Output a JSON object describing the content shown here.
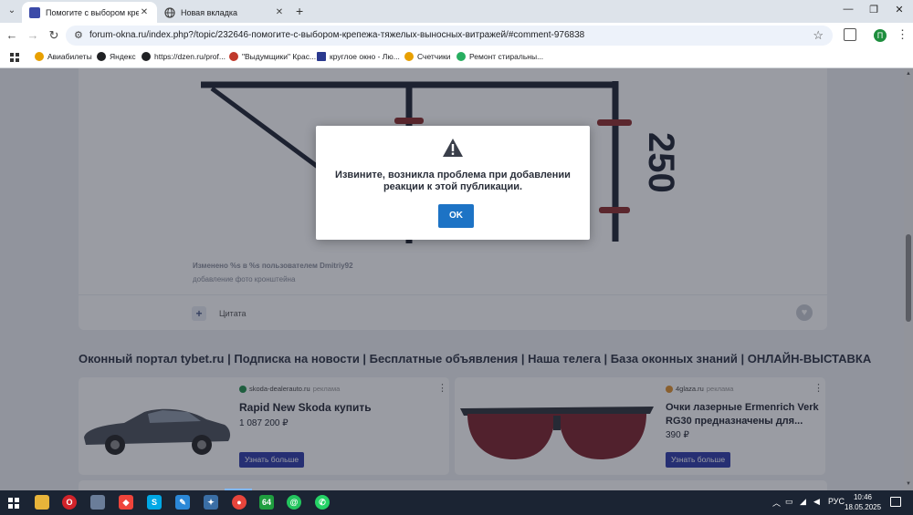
{
  "browser": {
    "tabs": [
      {
        "title": "Помогите с выбором крепежа",
        "active": true
      },
      {
        "title": "Новая вкладка",
        "active": false
      }
    ],
    "url": "forum-okna.ru/index.php?/topic/232646-помогите-с-выбором-крепежа-тяжелых-выносных-витражей/#comment-976838",
    "profile_letter": "П",
    "bookmarks": [
      {
        "label": "Авиабилеты",
        "icon": "plane-icon",
        "color": "#e8a000"
      },
      {
        "label": "Яндекс",
        "icon": "yandex-icon",
        "color": "#202124"
      },
      {
        "label": "https://dzen.ru/prof...",
        "icon": "dzen-icon",
        "color": "#202124"
      },
      {
        "label": "\"Выдумщики\" Крас...",
        "icon": "vydumshchiki-icon",
        "color": "#c0392b"
      },
      {
        "label": "круглое окно - Лю...",
        "icon": "bookmark-icon",
        "color": "#2b3a8f"
      },
      {
        "label": "Счетчики",
        "icon": "counter-icon",
        "color": "#e8a000"
      },
      {
        "label": "Ремонт стиральны...",
        "icon": "repair-icon",
        "color": "#27ae60"
      }
    ]
  },
  "post": {
    "dimension_label": "250",
    "edit_info": "Изменено %s в %s пользователем Dmitriy92",
    "edit_reason": "добавление фото кронштейна",
    "quote_label": "Цитата"
  },
  "footer": {
    "links": "Оконный портал tybet.ru | Подписка на новости | Бесплатные объявления | Наша телега | База оконных знаний | ОНЛАЙН-ВЫСТАВКА"
  },
  "ads": [
    {
      "source": "skoda-dealerauto.ru",
      "tag": "реклама",
      "headline": "Rapid New Skoda купить",
      "price": "1 087 200 ₽",
      "cta": "Узнать больше",
      "source_color": "#1f8f4a"
    },
    {
      "source": "4glaza.ru",
      "tag": "реклама",
      "headline_line1": "Очки лазерные Ermenrich Verk",
      "headline_line2": "RG30 предназначены для...",
      "price": "390 ₽",
      "cta": "Узнать больше",
      "source_color": "#e0902a"
    }
  ],
  "dialog": {
    "message_line1": "Извините, возникла проблема при добавлении",
    "message_line2": "реакции к этой публикации.",
    "ok_label": "OK",
    "accent": "#1d73c5"
  },
  "taskbar": {
    "apps": [
      {
        "name": "file-explorer",
        "color": "#e8b43a",
        "glyph": ""
      },
      {
        "name": "opera",
        "color": "#d2232a",
        "glyph": "O"
      },
      {
        "name": "photos",
        "color": "#6a7d99",
        "glyph": ""
      },
      {
        "name": "anydesk",
        "color": "#ef443b",
        "glyph": ""
      },
      {
        "name": "skype",
        "color": "#00a8e6",
        "glyph": "S"
      },
      {
        "name": "paint",
        "color": "#2b88d8",
        "glyph": ""
      },
      {
        "name": "tool",
        "color": "#3a6ea5",
        "glyph": ""
      },
      {
        "name": "chrome",
        "color": "#e8453c",
        "glyph": ""
      },
      {
        "name": "aida64",
        "color": "#1f9e3f",
        "glyph": "64"
      },
      {
        "name": "messenger",
        "color": "#23c55e",
        "glyph": "@"
      },
      {
        "name": "whatsapp",
        "color": "#25d366",
        "glyph": ""
      }
    ],
    "language": "РУС",
    "time": "10:46",
    "date": "18.05.2025"
  },
  "colors": {
    "active_taskbar_indicator": "#7eb6ff",
    "cta_button": "#2d3aa8"
  }
}
